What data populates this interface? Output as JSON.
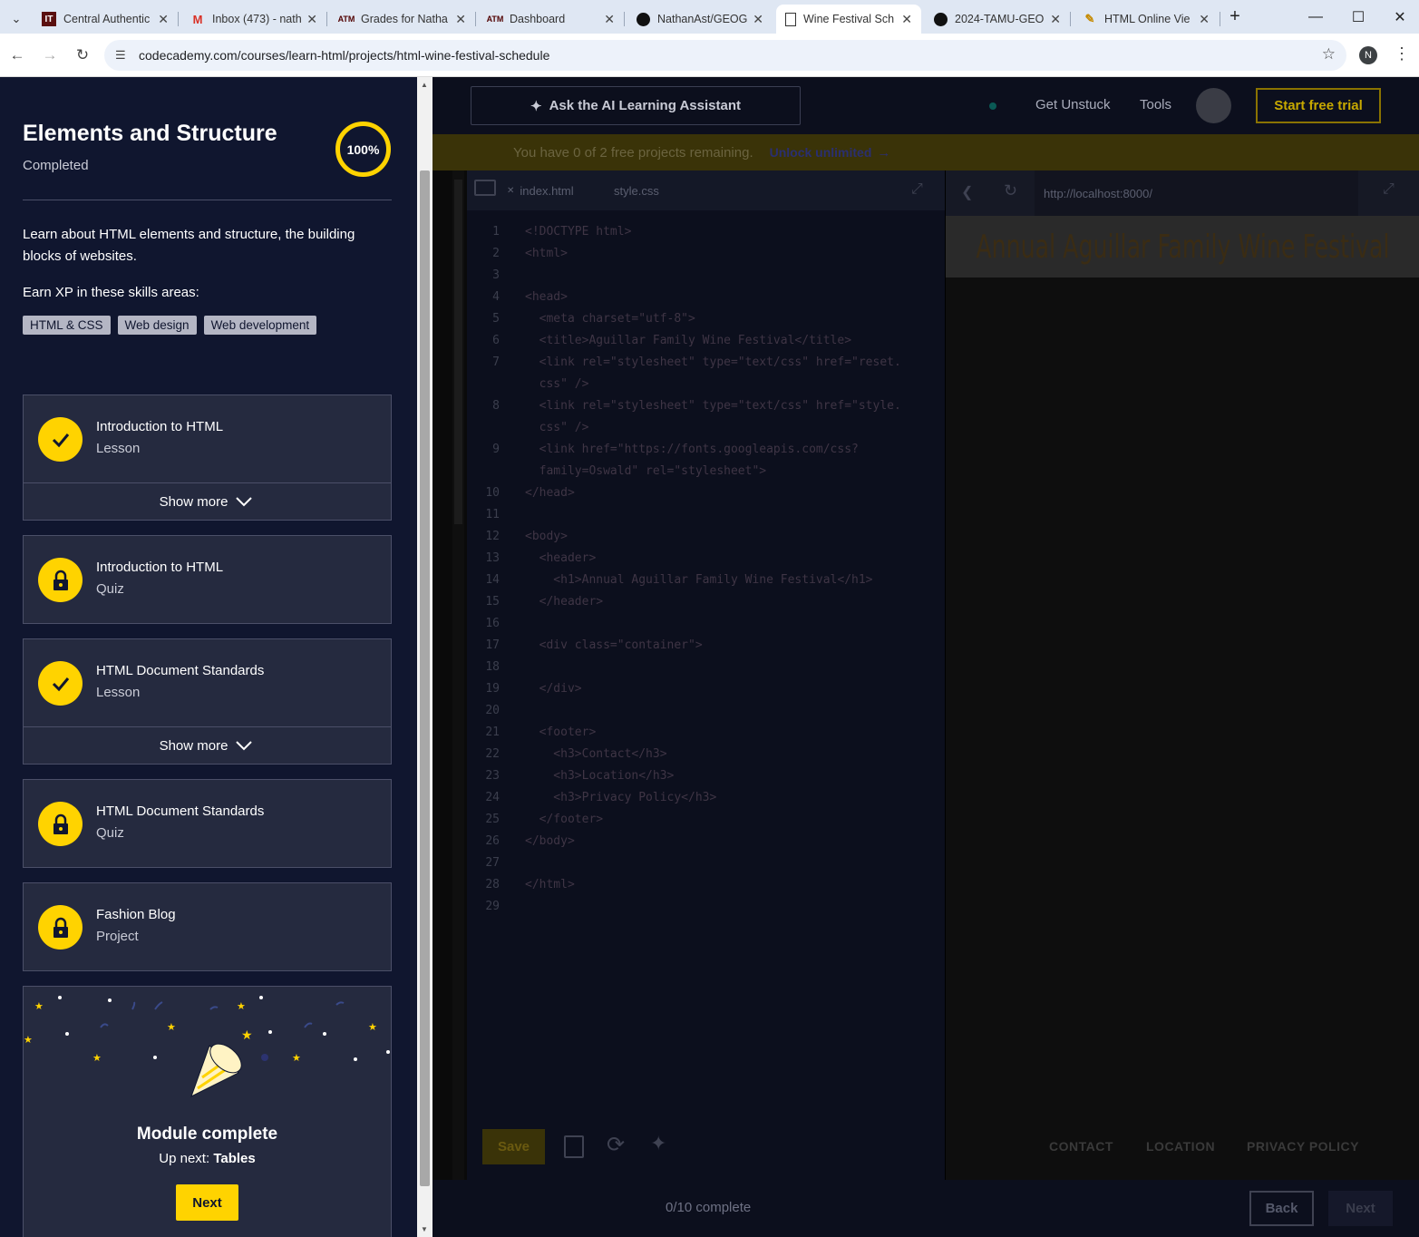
{
  "browser": {
    "tabs": [
      {
        "title": "Central Authentic",
        "icon": "IT"
      },
      {
        "title": "Inbox (473) - nath",
        "icon": "M"
      },
      {
        "title": "Grades for Natha",
        "icon": "ATM"
      },
      {
        "title": "Dashboard",
        "icon": "ATM"
      },
      {
        "title": "NathanAst/GEOG",
        "icon": "github"
      },
      {
        "title": "Wine Festival Sch",
        "icon": "doc",
        "active": true
      },
      {
        "title": "2024-TAMU-GEO",
        "icon": "github"
      },
      {
        "title": "HTML Online Vie",
        "icon": "pencil"
      }
    ],
    "url": "codecademy.com/courses/learn-html/projects/html-wine-festival-schedule",
    "profile_initial": "N"
  },
  "sidebar": {
    "title": "Elements and Structure",
    "subtitle": "Completed",
    "progress": "100%",
    "description": "Learn about HTML elements and structure, the building blocks of websites.",
    "earn_label": "Earn XP in these skills areas:",
    "skills": [
      "HTML & CSS",
      "Web design",
      "Web development"
    ],
    "items": [
      {
        "title": "Introduction to HTML",
        "type": "Lesson",
        "status": "done",
        "show_more": "Show more"
      },
      {
        "title": "Introduction to HTML",
        "type": "Quiz",
        "status": "locked"
      },
      {
        "title": "HTML Document Standards",
        "type": "Lesson",
        "status": "done",
        "show_more": "Show more"
      },
      {
        "title": "HTML Document Standards",
        "type": "Quiz",
        "status": "locked"
      },
      {
        "title": "Fashion Blog",
        "type": "Project",
        "status": "locked"
      }
    ],
    "module": {
      "title": "Module complete",
      "up_next_label": "Up next:",
      "up_next_value": "Tables",
      "next_button": "Next"
    }
  },
  "workspace": {
    "ai_button": "Ask the AI Learning Assistant",
    "get_unstuck": "Get Unstuck",
    "tools": "Tools",
    "trial_button": "Start free trial",
    "banner_text": "You have 0 of 2 free projects remaining.",
    "banner_link": "Unlock unlimited",
    "editor_tabs": [
      "index.html",
      "style.css"
    ],
    "code_lines": [
      "<!DOCTYPE html>",
      "<html>",
      "",
      "<head>",
      "  <meta charset=\"utf-8\">",
      "  <title>Aguillar Family Wine Festival</title>",
      "  <link rel=\"stylesheet\" type=\"text/css\" href=\"reset.",
      "  css\" />",
      "  <link rel=\"stylesheet\" type=\"text/css\" href=\"style.",
      "  css\" />",
      "  <link href=\"https://fonts.googleapis.com/css?",
      "  family=Oswald\" rel=\"stylesheet\">",
      "</head>",
      "",
      "<body>",
      "  <header>",
      "    <h1>Annual Aguillar Family Wine Festival</h1>",
      "  </header>",
      "",
      "  <div class=\"container\">",
      "",
      "  </div>",
      "",
      "  <footer>",
      "    <h3>Contact</h3>",
      "    <h3>Location</h3>",
      "    <h3>Privacy Policy</h3>",
      "  </footer>",
      "</body>",
      "",
      "</html>",
      ""
    ],
    "line_numbers": [
      "1",
      "2",
      "3",
      "4",
      "5",
      "6",
      "7",
      "",
      "8",
      "",
      "9",
      "",
      "10",
      "11",
      "12",
      "13",
      "14",
      "15",
      "16",
      "17",
      "18",
      "19",
      "20",
      "21",
      "22",
      "23",
      "24",
      "25",
      "26",
      "27",
      "28",
      "29"
    ],
    "preview_url": "http://localhost:8000/",
    "preview_heading": "Annual Aguillar Family Wine Festival",
    "preview_footer": [
      "CONTACT",
      "LOCATION",
      "PRIVACY POLICY"
    ],
    "save_button": "Save",
    "progress_text": "0/10 complete",
    "back_button": "Back",
    "next_button": "Next"
  }
}
